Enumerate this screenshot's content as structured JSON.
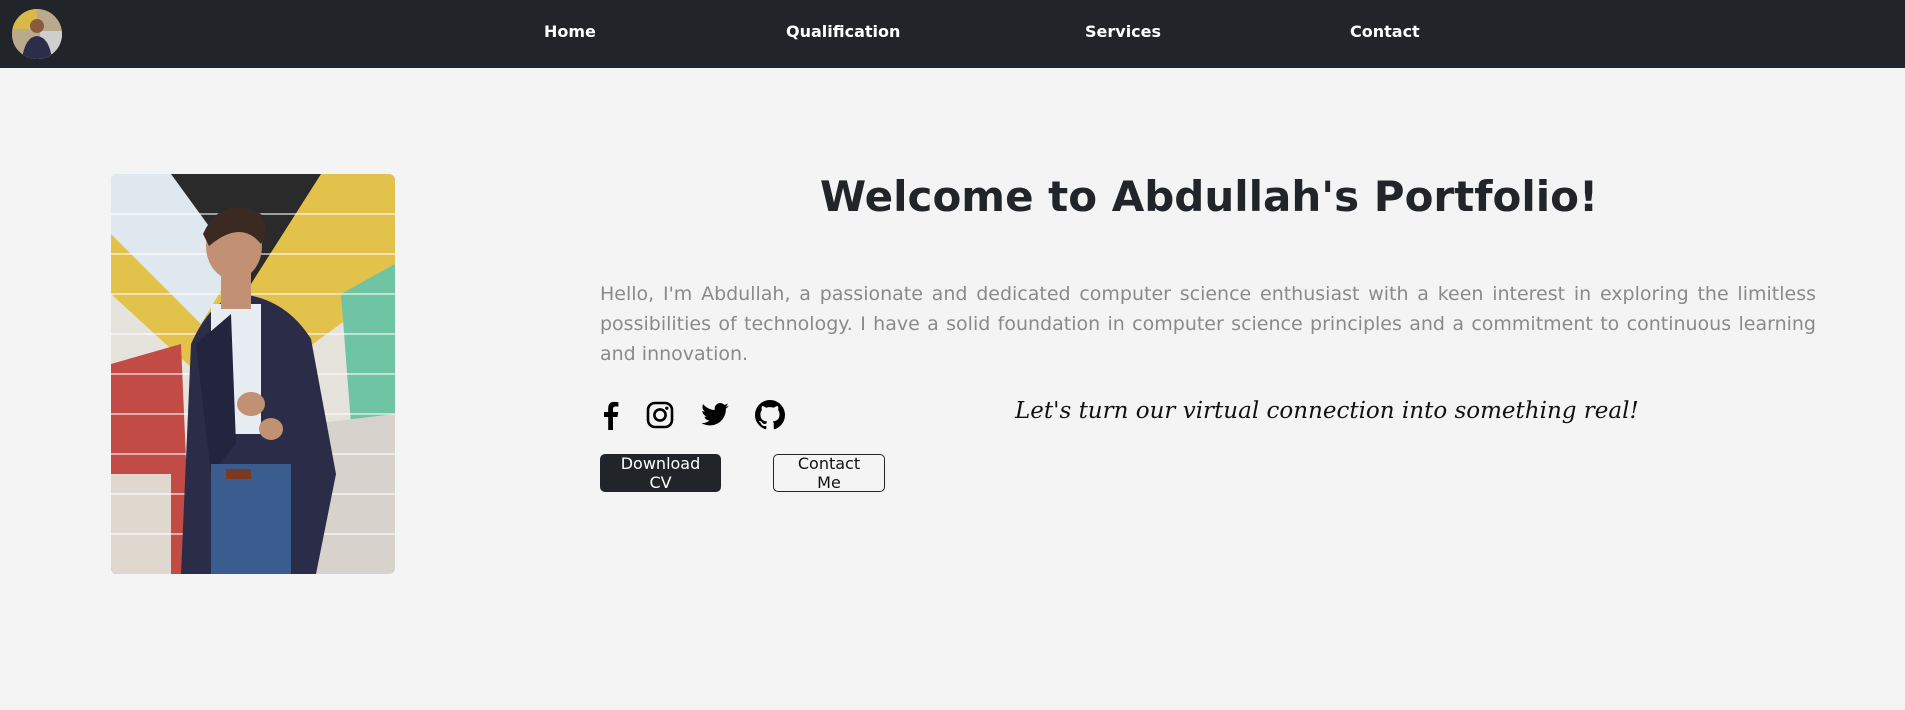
{
  "nav": {
    "avatar_alt": "Abdullah avatar",
    "links": [
      {
        "label": "Home"
      },
      {
        "label": "Qualification"
      },
      {
        "label": "Services"
      },
      {
        "label": "Contact"
      }
    ]
  },
  "hero": {
    "title": "Welcome to Abdullah's Portfolio!",
    "bio": "Hello, I'm Abdullah, a passionate and dedicated computer science enthusiast with a keen interest in exploring the limitless possibilities of technology. I have a solid foundation in computer science principles and a commitment to continuous learning and innovation.",
    "tagline": "Let's turn our virtual connection into something real!",
    "social_icons": [
      "facebook-icon",
      "instagram-icon",
      "twitter-icon",
      "github-icon"
    ],
    "buttons": {
      "download_cv": "Download CV",
      "contact_me": "Contact Me"
    }
  },
  "colors": {
    "navbar_bg": "#212529",
    "page_bg": "#f4f4f4",
    "text_muted": "#8a8a8a",
    "text_dark": "#212529"
  }
}
